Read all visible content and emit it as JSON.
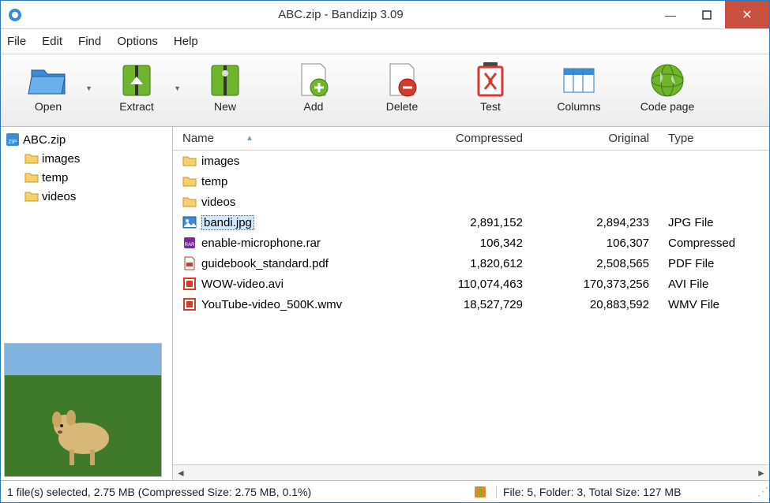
{
  "title": "ABC.zip - Bandizip 3.09",
  "menu": {
    "file": "File",
    "edit": "Edit",
    "find": "Find",
    "options": "Options",
    "help": "Help"
  },
  "toolbar": {
    "open": "Open",
    "extract": "Extract",
    "new": "New",
    "add": "Add",
    "delete": "Delete",
    "test": "Test",
    "columns": "Columns",
    "codepage": "Code page"
  },
  "tree": {
    "root": "ABC.zip",
    "children": [
      {
        "label": "images"
      },
      {
        "label": "temp"
      },
      {
        "label": "videos"
      }
    ]
  },
  "columns": {
    "name": "Name",
    "compressed": "Compressed",
    "original": "Original",
    "type": "Type"
  },
  "rows": [
    {
      "name": "images",
      "compressed": "",
      "original": "",
      "type": "",
      "kind": "folder"
    },
    {
      "name": "temp",
      "compressed": "",
      "original": "",
      "type": "",
      "kind": "folder"
    },
    {
      "name": "videos",
      "compressed": "",
      "original": "",
      "type": "",
      "kind": "folder"
    },
    {
      "name": "bandi.jpg",
      "compressed": "2,891,152",
      "original": "2,894,233",
      "type": "JPG File",
      "kind": "image",
      "selected": true
    },
    {
      "name": "enable-microphone.rar",
      "compressed": "106,342",
      "original": "106,307",
      "type": "Compressed",
      "kind": "rar"
    },
    {
      "name": "guidebook_standard.pdf",
      "compressed": "1,820,612",
      "original": "2,508,565",
      "type": "PDF File",
      "kind": "pdf"
    },
    {
      "name": "WOW-video.avi",
      "compressed": "110,074,463",
      "original": "170,373,256",
      "type": "AVI File",
      "kind": "video"
    },
    {
      "name": "YouTube-video_500K.wmv",
      "compressed": "18,527,729",
      "original": "20,883,592",
      "type": "WMV File",
      "kind": "video"
    }
  ],
  "status": {
    "left": "1 file(s) selected, 2.75 MB (Compressed Size: 2.75 MB, 0.1%)",
    "right": "File: 5, Folder: 3, Total Size: 127 MB"
  }
}
